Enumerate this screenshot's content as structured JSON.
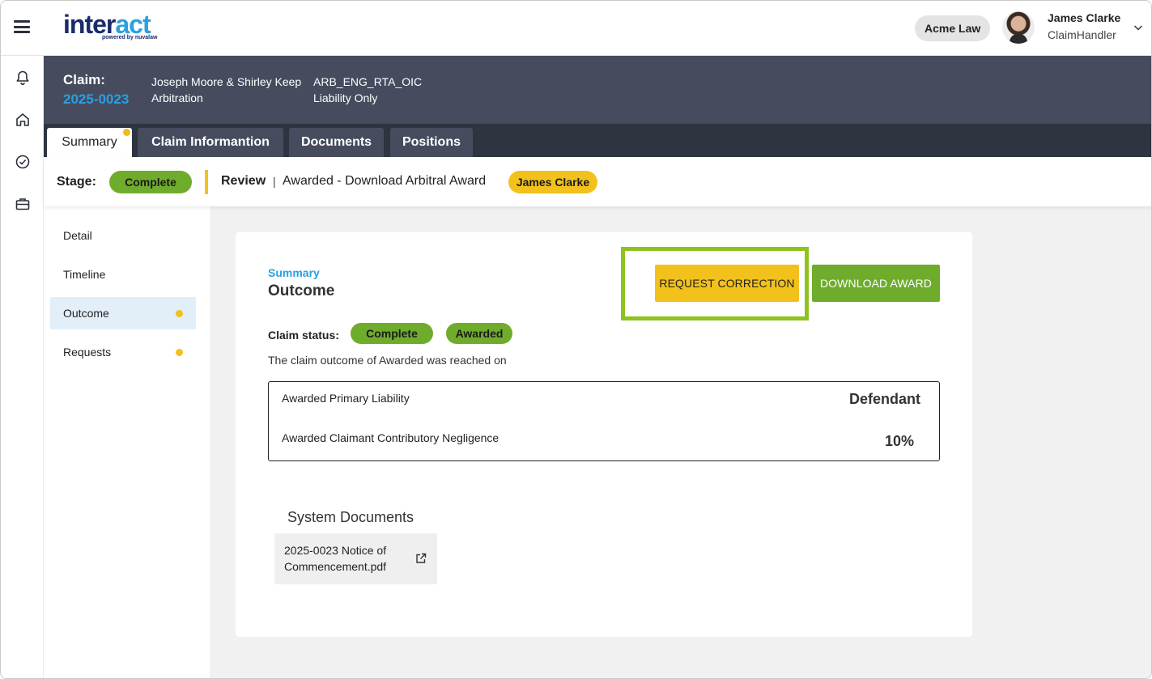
{
  "app": {
    "logo_primary": "inter",
    "logo_accent": "act",
    "logo_tagline": "powered by nuvalaw"
  },
  "header": {
    "organization": "Acme Law",
    "user_name": "James Clarke",
    "user_role": "ClaimHandler"
  },
  "claim": {
    "label": "Claim:",
    "number": "2025-0023",
    "parties": "Joseph Moore & Shirley Keep",
    "type": "Arbitration",
    "code": "ARB_ENG_RTA_OIC",
    "liability": "Liability Only"
  },
  "tabs": [
    {
      "label": "Summary",
      "active": true,
      "has_dot": true
    },
    {
      "label": "Claim Informantion",
      "active": false
    },
    {
      "label": "Documents",
      "active": false
    },
    {
      "label": "Positions",
      "active": false
    }
  ],
  "stage": {
    "label": "Stage:",
    "status": "Complete",
    "review_label": "Review",
    "separator": "|",
    "step": "Awarded - Download Arbitral Award",
    "assignee": "James Clarke"
  },
  "sidenav": [
    {
      "label": "Detail",
      "active": false,
      "has_dot": false
    },
    {
      "label": "Timeline",
      "active": false,
      "has_dot": false
    },
    {
      "label": "Outcome",
      "active": true,
      "has_dot": true
    },
    {
      "label": "Requests",
      "active": false,
      "has_dot": true
    }
  ],
  "outcome": {
    "breadcrumb": "Summary",
    "title": "Outcome",
    "request_correction_label": "REQUEST CORRECTION",
    "download_award_label": "DOWNLOAD AWARD",
    "claim_status_label": "Claim status:",
    "status_pills": [
      "Complete",
      "Awarded"
    ],
    "note": "The claim outcome of Awarded was reached on",
    "rows": [
      {
        "label": "Awarded Primary Liability",
        "value": "Defendant"
      },
      {
        "label": "Awarded Claimant Contributory Negligence",
        "value": "10%"
      }
    ],
    "system_documents_title": "System Documents",
    "documents": [
      {
        "name": "2025-0023 Notice of Commencement.pdf"
      }
    ]
  },
  "colors": {
    "header_bg": "#464c5e",
    "tabbar_bg": "#2f3441",
    "accent_blue": "#2aa0e0",
    "green": "#6fac2c",
    "yellow": "#f2c11c",
    "highlight": "#8ec21f"
  },
  "icons": {
    "menu": "hamburger-icon",
    "bell": "bell-icon",
    "home": "home-icon",
    "check": "check-circle-icon",
    "briefcase": "briefcase-icon",
    "chevron": "chevron-down-icon",
    "external": "external-link-icon"
  }
}
